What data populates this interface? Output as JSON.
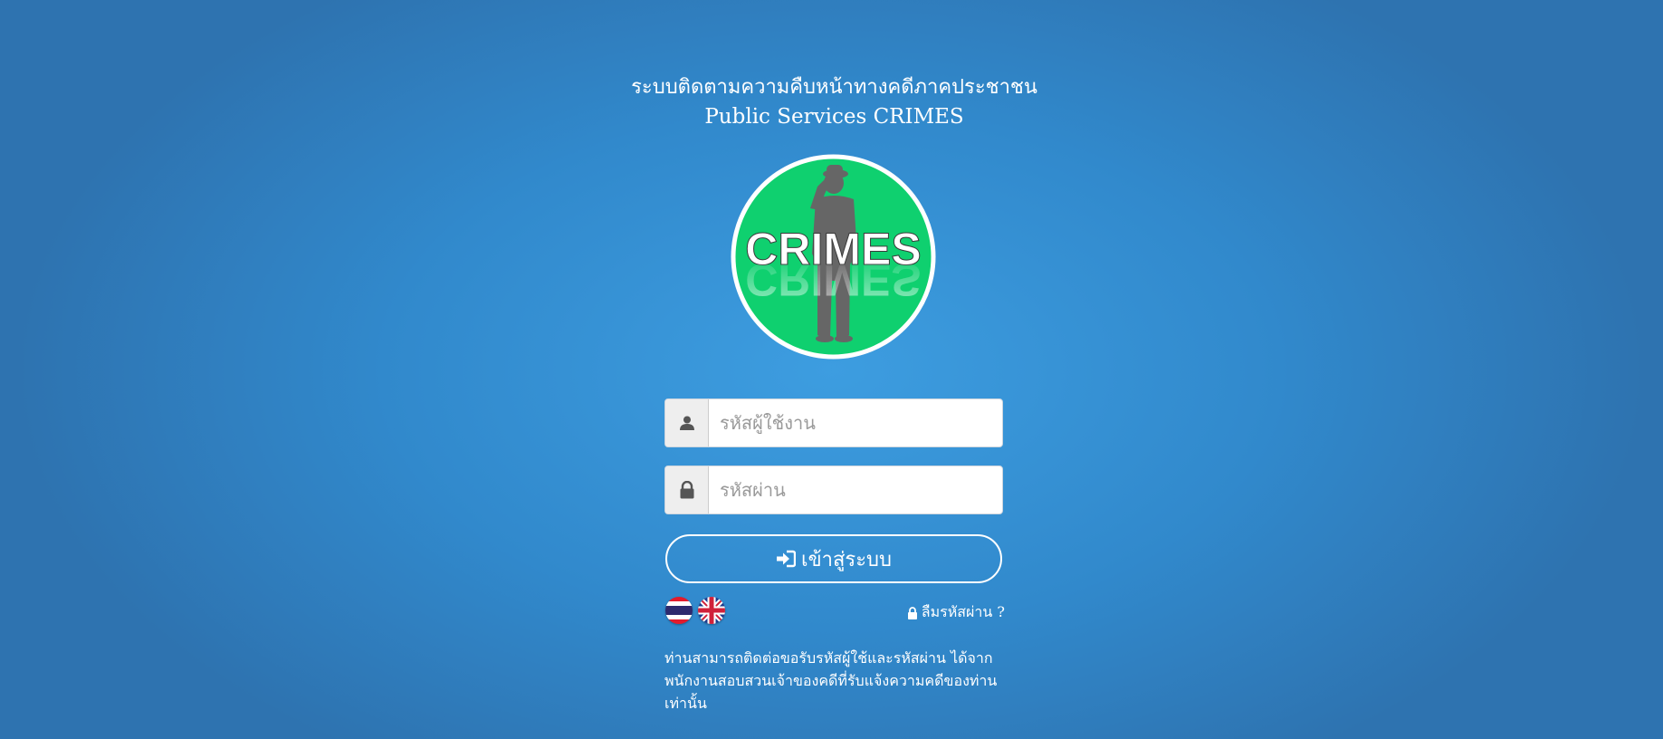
{
  "header": {
    "title_th": "ระบบติดตามความคืบหน้าทางคดีภาคประชาชน",
    "title_en": "Public Services CRIMES"
  },
  "logo": {
    "text": "CRIMES",
    "icon": "crimes-logo-saluting-officer",
    "circle_color": "#0fd06f"
  },
  "form": {
    "username": {
      "placeholder": "รหัสผู้ใช้งาน",
      "value": "",
      "icon": "user-icon"
    },
    "password": {
      "placeholder": "รหัสผ่าน",
      "value": "",
      "icon": "lock-icon"
    },
    "login_label": "เข้าสู่ระบบ",
    "login_icon": "sign-in-icon"
  },
  "languages": [
    {
      "code": "th",
      "icon": "thai-flag-icon"
    },
    {
      "code": "en",
      "icon": "uk-flag-icon"
    }
  ],
  "forgot_password": "ลืมรหัสผ่าน ?",
  "note": "ท่านสามารถติดต่อขอรับรหัสผู้ใช้และรหัสผ่าน ได้จาก พนักงานสอบสวนเจ้าของคดีที่รับแจ้งความคดีของท่าน เท่านั้น"
}
